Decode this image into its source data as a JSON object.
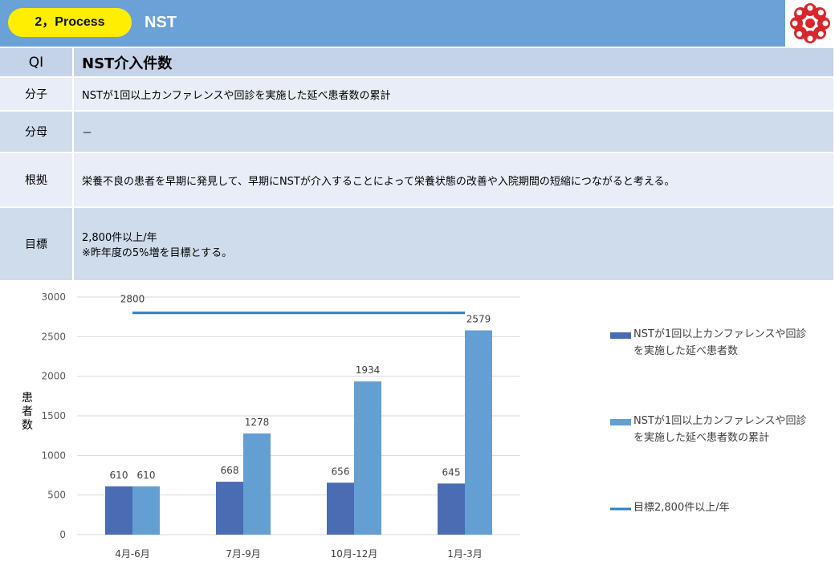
{
  "header": {
    "section_badge": "2，Process",
    "title": "NST"
  },
  "qi_table": {
    "qi_key": "QI",
    "qi_value": "NST介入件数",
    "numerator_key": "分子",
    "numerator_value": "NSTが1回以上カンファレンスや回診を実施した延べ患者数の累計",
    "denominator_key": "分母",
    "denominator_value": "－",
    "basis_key": "根拠",
    "basis_value": "栄養不良の患者を早期に発見して、早期にNSTが介入することによって栄養状態の改善や入院期間の短縮につながると考える。",
    "target_key": "目標",
    "target_line1": "2,800件以上/年",
    "target_line2": "※昨年度の5%増を目標とする。"
  },
  "chart_data": {
    "type": "bar",
    "categories": [
      "4月-6月",
      "7月-9月",
      "10月-12月",
      "1月-3月"
    ],
    "series": [
      {
        "name": "NSTが1回以上カンファレンスや回診を実施した延べ患者数",
        "values": [
          610,
          668,
          656,
          645
        ],
        "color": "#4a6cb3"
      },
      {
        "name": "NSTが1回以上カンファレンスや回診を実施した延べ患者数の累計",
        "values": [
          610,
          1278,
          1934,
          2579
        ],
        "color": "#649fd4"
      }
    ],
    "target_line": {
      "name": "目標2,800件以上/年",
      "value": 2800,
      "label": "2800",
      "color": "#2f7cc2"
    },
    "ylabel": "患者数",
    "ylim": [
      0,
      3000
    ],
    "yticks": [
      0,
      500,
      1000,
      1500,
      2000,
      2500,
      3000
    ],
    "grid": true,
    "legend_position": "right"
  }
}
